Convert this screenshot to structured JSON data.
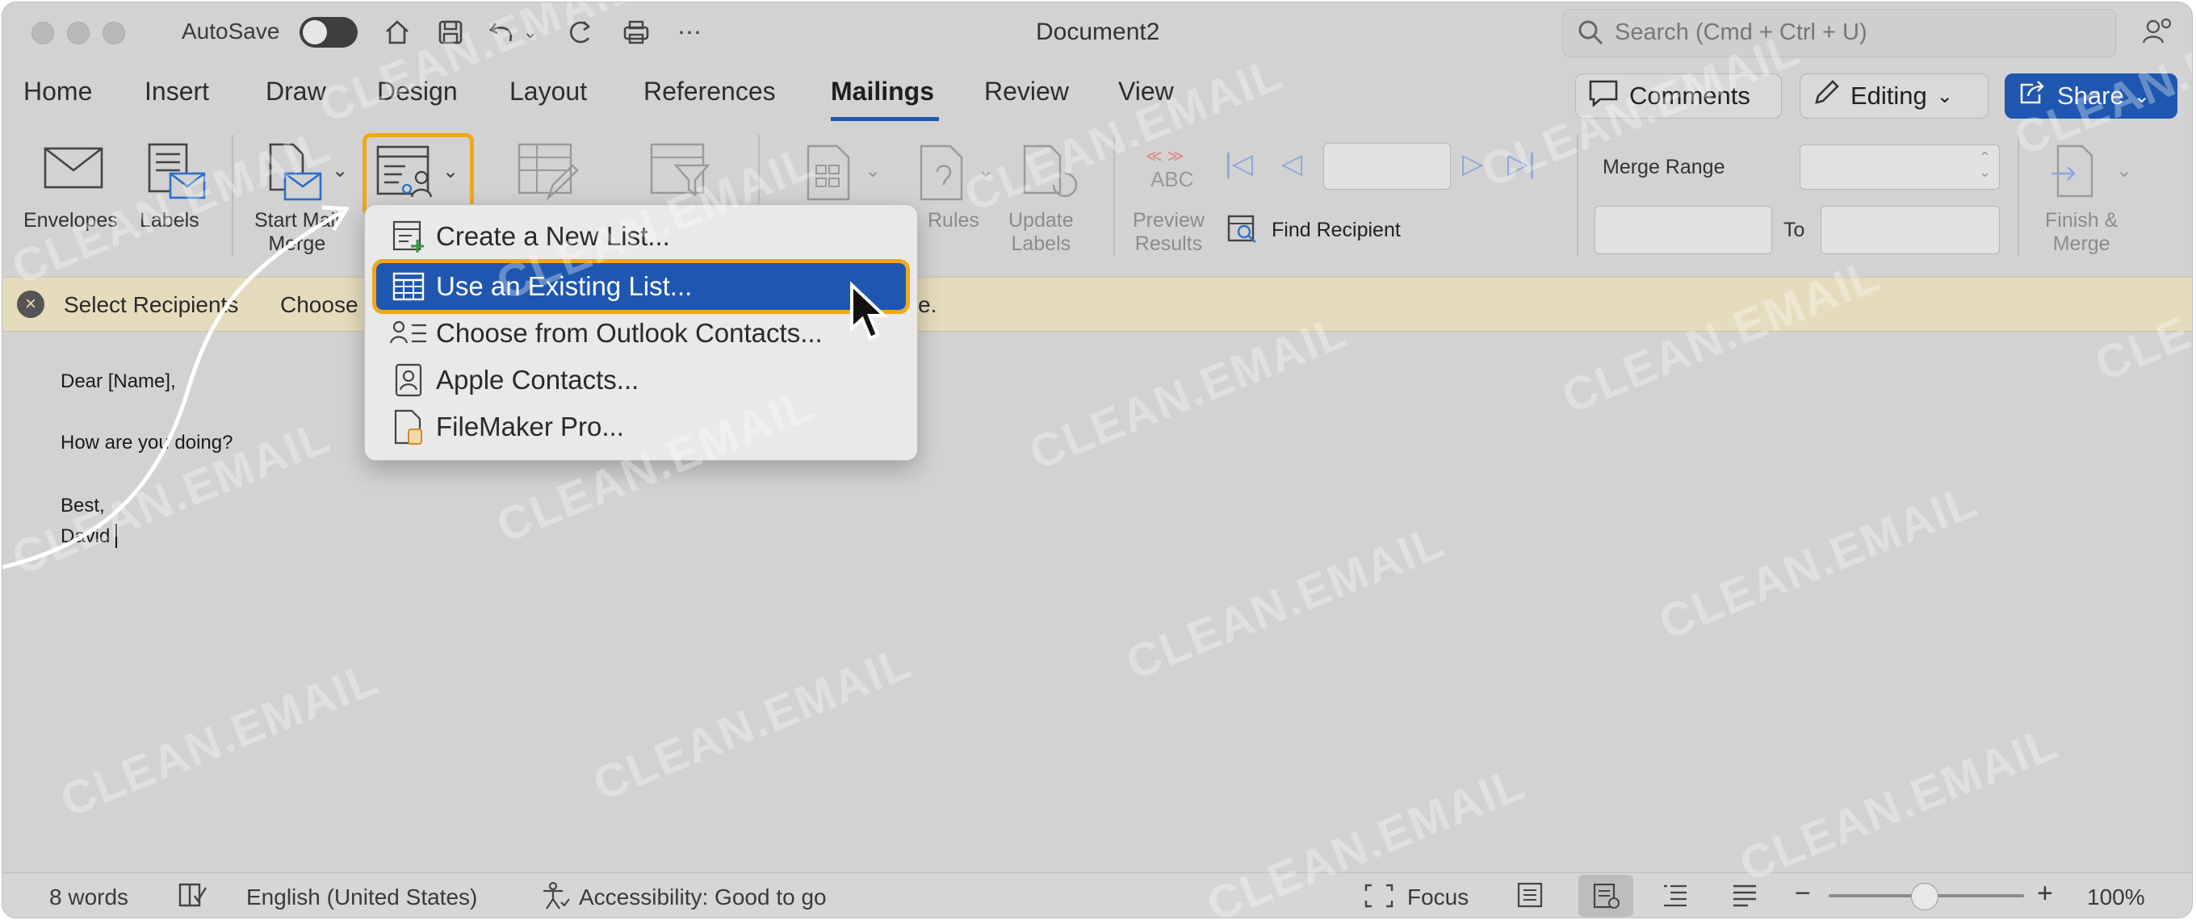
{
  "titlebar": {
    "autosave_label": "AutoSave",
    "document_title": "Document2",
    "search_placeholder": "Search (Cmd + Ctrl + U)"
  },
  "tabs": [
    "Home",
    "Insert",
    "Draw",
    "Design",
    "Layout",
    "References",
    "Mailings",
    "Review",
    "View"
  ],
  "active_tab": "Mailings",
  "header_buttons": {
    "comments": "Comments",
    "editing": "Editing",
    "share": "Share"
  },
  "ribbon": {
    "envelopes": "Envelopes",
    "labels": "Labels",
    "start_mail_merge_line1": "Start Mail",
    "start_mail_merge_line2": "Merge",
    "rules": "Rules",
    "update_labels_line1": "Update",
    "update_labels_line2": "Labels",
    "preview_results_line1": "Preview",
    "preview_results_line2": "Results",
    "abc": "ABC",
    "find_recipient": "Find Recipient",
    "merge_range": "Merge Range",
    "to": "To",
    "finish_merge_line1": "Finish &",
    "finish_merge_line2": "Merge"
  },
  "infobar": {
    "select_recipients": "Select Recipients",
    "choose": "Choose",
    "trailing": "e."
  },
  "dropdown_menu": {
    "items": [
      {
        "label": "Create a New List...",
        "icon": "new-list-icon"
      },
      {
        "label": "Use an Existing List...",
        "icon": "existing-list-icon",
        "highlighted": true
      },
      {
        "label": "Choose from Outlook Contacts...",
        "icon": "outlook-contacts-icon"
      },
      {
        "label": "Apple Contacts...",
        "icon": "apple-contacts-icon"
      },
      {
        "label": "FileMaker Pro...",
        "icon": "filemaker-icon"
      }
    ]
  },
  "document": {
    "line1": "Dear [Name],",
    "line2": "How are you doing?",
    "line3": "Best,",
    "line4": "David"
  },
  "statusbar": {
    "word_count": "8 words",
    "language": "English (United States)",
    "accessibility": "Accessibility: Good to go",
    "focus": "Focus",
    "zoom": "100%"
  },
  "watermark_text": "CLEAN.EMAIL",
  "colors": {
    "accent": "#1f57b0",
    "highlight_outline": "#f2a71b",
    "infobar": "#e5dcbd"
  }
}
